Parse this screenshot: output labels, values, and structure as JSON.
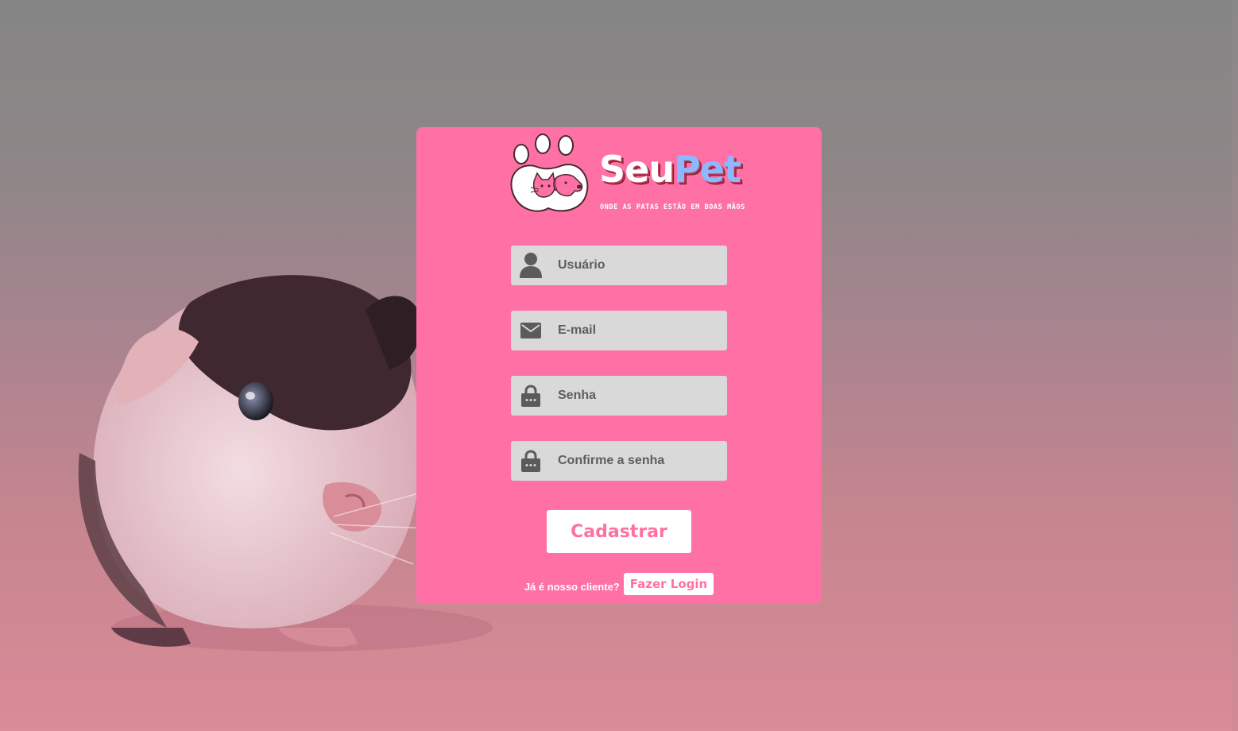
{
  "brand": {
    "name_part1": "Seu",
    "name_part2": "Pet",
    "tagline": "ONDE AS PATAS ESTÃO EM BOAS MÃOS"
  },
  "form": {
    "username_placeholder": "Usuário",
    "email_placeholder": "E-mail",
    "password_placeholder": "Senha",
    "confirm_password_placeholder": "Confirme a senha",
    "submit_label": "Cadastrar"
  },
  "footer": {
    "question": "Já é nosso cliente?",
    "login_label": "Fazer Login"
  },
  "colors": {
    "card": "#ff71a4",
    "field": "#d9d9d9",
    "icon": "#5b5b5b",
    "button_bg": "#ffffff",
    "button_text": "#ff71a4"
  },
  "icons": {
    "username": "user-icon",
    "email": "envelope-icon",
    "password": "lock-icon",
    "confirm_password": "lock-icon"
  }
}
